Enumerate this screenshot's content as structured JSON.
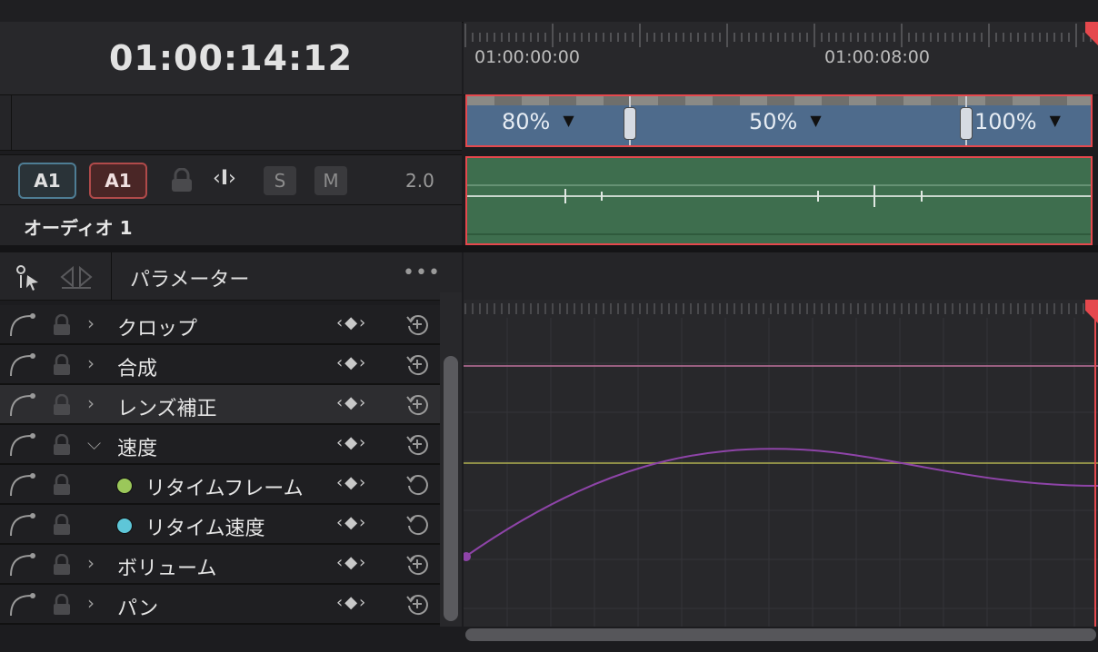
{
  "timecode": "01:00:14:12",
  "ruler": {
    "labels": [
      "01:00:00:00",
      "01:00:08:00"
    ]
  },
  "video_clip": {
    "segments": [
      {
        "speed": "80%"
      },
      {
        "speed": "50%"
      },
      {
        "speed": "100%"
      }
    ]
  },
  "audio_track": {
    "source_button": "A1",
    "dest_button": "A1",
    "solo": "S",
    "mute": "M",
    "value": "2.0",
    "name": "オーディオ 1"
  },
  "params": {
    "title": "パラメーター",
    "rows": [
      {
        "label": "クロップ",
        "chevron": ">"
      },
      {
        "label": "合成",
        "chevron": ">"
      },
      {
        "label": "レンズ補正",
        "chevron": ">"
      },
      {
        "label": "速度",
        "chevron": "v"
      },
      {
        "label": "リタイムフレーム",
        "dot_color": "#9bc75a"
      },
      {
        "label": "リタイム速度",
        "dot_color": "#5ec6d8"
      },
      {
        "label": "ボリューム",
        "chevron": ">"
      },
      {
        "label": "パン",
        "chevron": ">"
      }
    ],
    "keyframe_nav": "‹◆›"
  },
  "colors": {
    "accent_red": "#e5484d",
    "video_clip": "#4e6b8c",
    "audio_clip": "#3e6e4e",
    "curve_purple": "#8e44a8",
    "line_pink": "#b56c95",
    "line_yellow": "#a8a84e"
  }
}
